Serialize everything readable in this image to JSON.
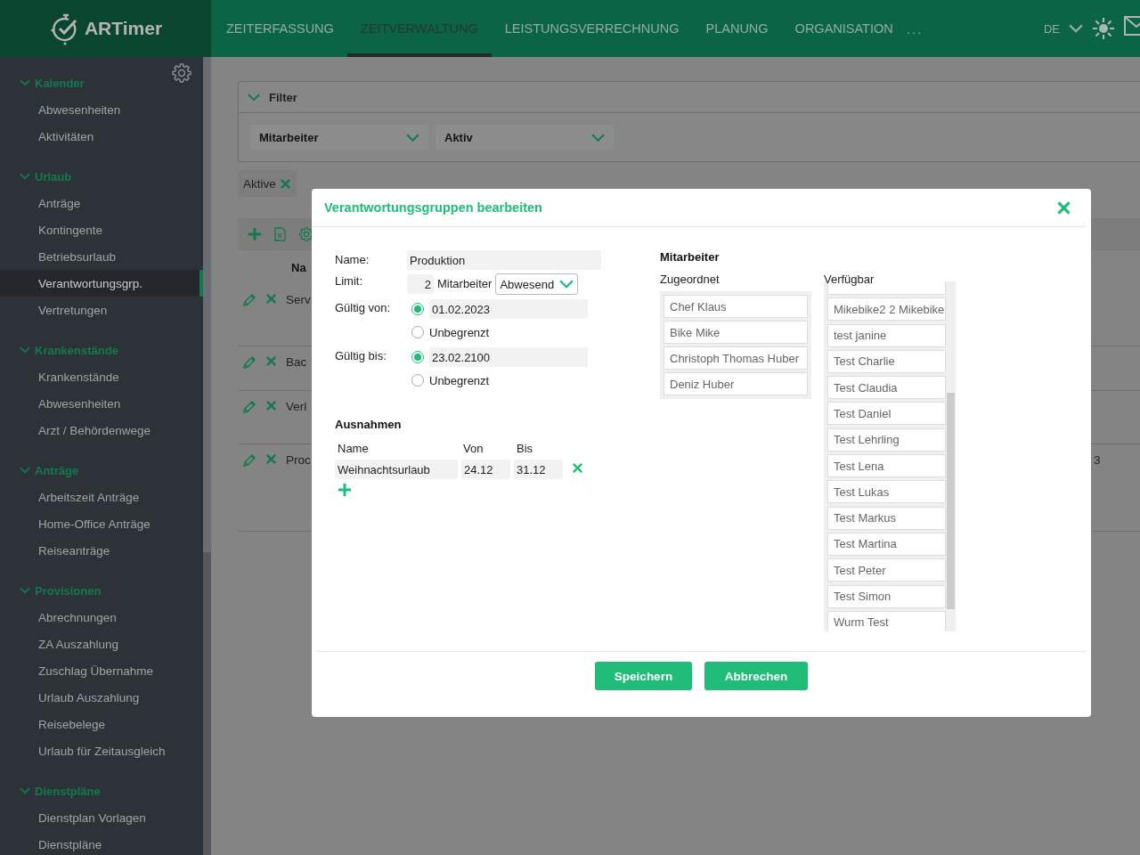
{
  "app": {
    "logo": "ARTimer"
  },
  "nav": [
    {
      "label": "ZEITERFASSUNG",
      "selected": false
    },
    {
      "label": "ZEITVERWALTUNG",
      "selected": true
    },
    {
      "label": "LEISTUNGSVERRECHNUNG",
      "selected": false
    },
    {
      "label": "PLANUNG",
      "selected": false
    },
    {
      "label": "ORGANISATION",
      "selected": false
    }
  ],
  "nav_more": "...",
  "language": "DE",
  "sidebar": {
    "sections": [
      {
        "title": "Kalender",
        "expanded": true,
        "items": [
          {
            "label": "Abwesenheiten",
            "selected": false
          },
          {
            "label": "Aktivitäten",
            "selected": false
          }
        ]
      },
      {
        "title": "Urlaub",
        "expanded": true,
        "items": [
          {
            "label": "Anträge",
            "selected": false
          },
          {
            "label": "Kontingente",
            "selected": false
          },
          {
            "label": "Betriebsurlaub",
            "selected": false
          },
          {
            "label": "Verantwortungsgrp.",
            "selected": true
          },
          {
            "label": "Vertretungen",
            "selected": false
          }
        ]
      },
      {
        "title": "Krankenstände",
        "expanded": true,
        "items": [
          {
            "label": "Krankenstände",
            "selected": false
          },
          {
            "label": "Abwesenheiten",
            "selected": false
          },
          {
            "label": "Arzt / Behördenwege",
            "selected": false
          }
        ]
      },
      {
        "title": "Anträge",
        "expanded": true,
        "items": [
          {
            "label": "Arbeitszeit Anträge",
            "selected": false
          },
          {
            "label": "Home-Office Anträge",
            "selected": false
          },
          {
            "label": "Reiseanträge",
            "selected": false
          }
        ]
      },
      {
        "title": "Provisionen",
        "expanded": true,
        "items": [
          {
            "label": "Abrechnungen",
            "selected": false
          },
          {
            "label": "ZA Auszahlung",
            "selected": false
          },
          {
            "label": "Zuschlag Übernahme",
            "selected": false
          },
          {
            "label": "Urlaub Auszahlung",
            "selected": false
          },
          {
            "label": "Reisebelege",
            "selected": false
          },
          {
            "label": "Urlaub für Zeitausgleich",
            "selected": false
          }
        ]
      },
      {
        "title": "Dienstpläne",
        "expanded": true,
        "items": [
          {
            "label": "Dienstplan Vorlagen",
            "selected": false
          },
          {
            "label": "Dienstpläne",
            "selected": false
          }
        ]
      }
    ]
  },
  "filter": {
    "title": "Filter",
    "expanded": true,
    "selects": [
      "Mitarbeiter",
      "Aktiv"
    ]
  },
  "chips": [
    {
      "label": "Aktive"
    }
  ],
  "table": {
    "column_1": "Na",
    "rows": [
      {
        "column_1": "Serv"
      },
      {
        "column_1": "Bac"
      },
      {
        "column_1": "Verl"
      },
      {
        "column_1": "Proc",
        "column_2": "3"
      }
    ]
  },
  "modal": {
    "title": "Verantwortungsgruppen bearbeiten",
    "name": {
      "label": "Name:",
      "value": "Produktion"
    },
    "limit": {
      "label": "Limit:",
      "value": "2",
      "unit": "Mitarbeiter",
      "mode": "Abwesend"
    },
    "valid_from": {
      "label": "Gültig von:",
      "options": [
        {
          "kind": "date",
          "value": "01.02.2023",
          "selected": true
        },
        {
          "kind": "text",
          "label": "Unbegrenzt",
          "selected": false
        }
      ]
    },
    "valid_to": {
      "label": "Gültig bis:",
      "options": [
        {
          "kind": "date",
          "value": "23.02.2100",
          "selected": true
        },
        {
          "kind": "text",
          "label": "Unbegrenzt",
          "selected": false
        }
      ]
    },
    "exceptions": {
      "title": "Ausnahmen",
      "columns": [
        "Name",
        "Von",
        "Bis"
      ],
      "rows": [
        {
          "name": "Weihnachtsurlaub",
          "from": "24.12",
          "to": "31.12"
        }
      ]
    },
    "employees": {
      "title": "Mitarbeiter",
      "assigned_label": "Zugeordnet",
      "assigned": [
        "Chef Klaus",
        "Bike Mike",
        "Christoph Thomas Huber",
        "Deniz Huber"
      ],
      "available_label": "Verfügbar",
      "available": [
        "Mikebike2 2 Mikebike",
        "test janine",
        "Test Charlie",
        "Test Claudia",
        "Test Daniel",
        "Test Lehrling",
        "Test Lena",
        "Test Lukas",
        "Test Markus",
        "Test Martina",
        "Test Peter",
        "Test Simon",
        "Wurm Test"
      ]
    },
    "buttons": [
      "Speichern",
      "Abbrechen"
    ]
  }
}
